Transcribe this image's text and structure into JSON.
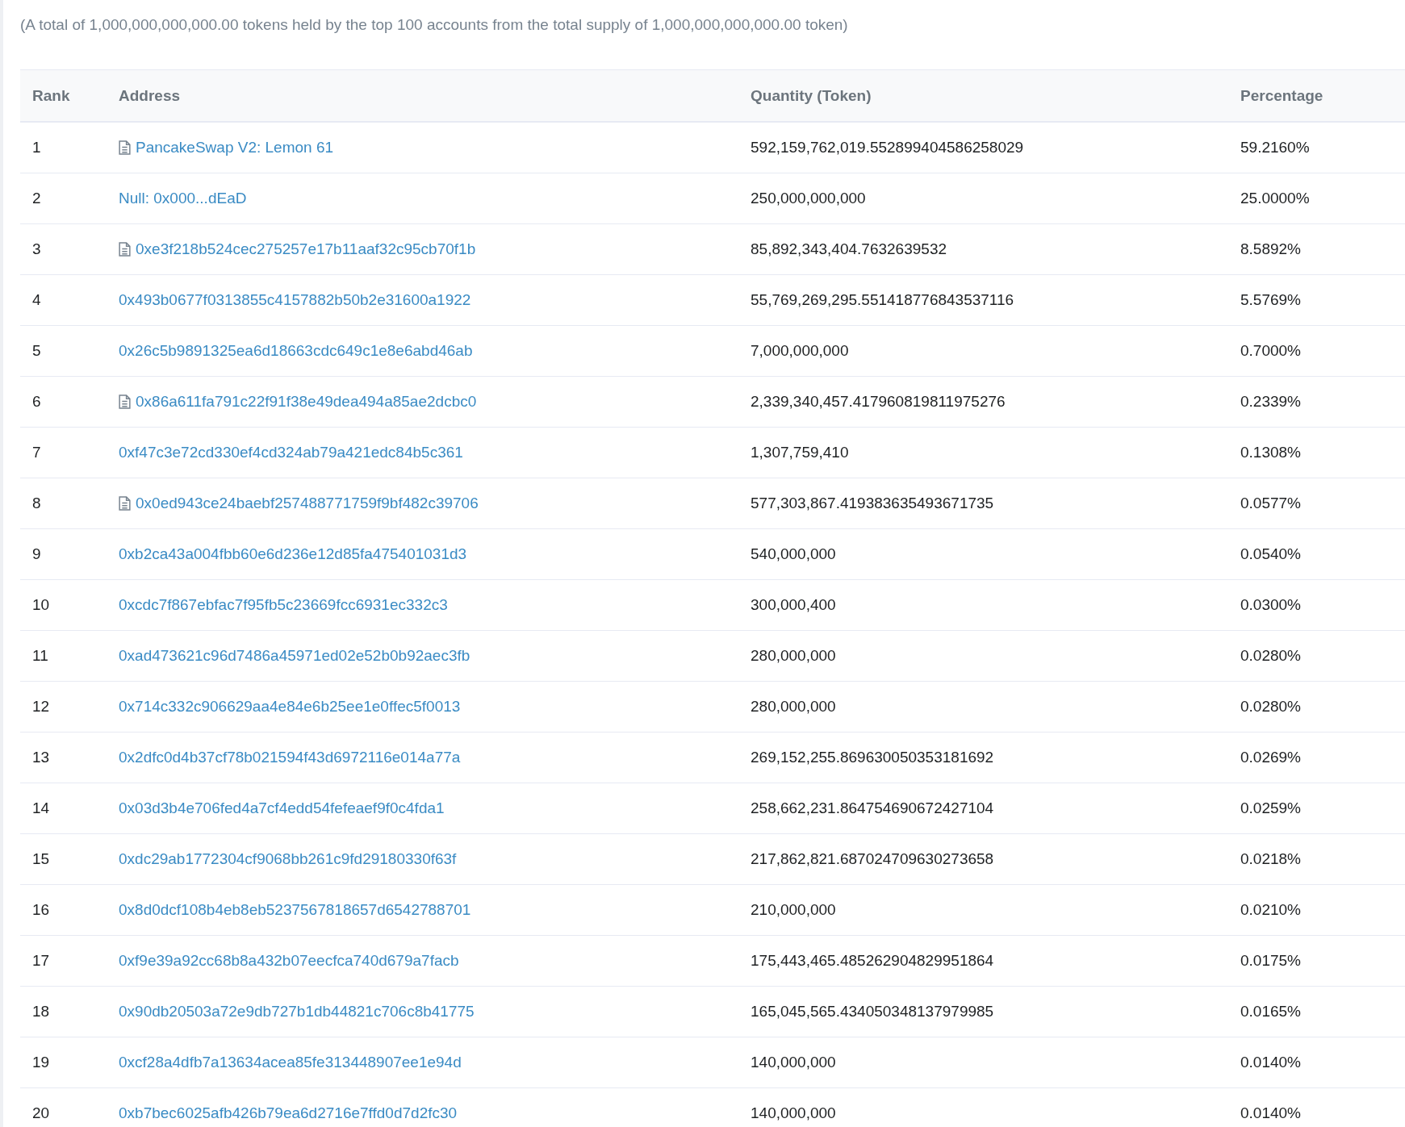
{
  "summary": "(A total of 1,000,000,000,000.00 tokens held by the top 100 accounts from the total supply of 1,000,000,000,000.00 token)",
  "table": {
    "columns": [
      "Rank",
      "Address",
      "Quantity (Token)",
      "Percentage"
    ],
    "rows": [
      {
        "rank": "1",
        "address": "PancakeSwap V2: Lemon 61",
        "contract": true,
        "quantity": "592,159,762,019.552899404586258029",
        "percentage": "59.2160%"
      },
      {
        "rank": "2",
        "address": "Null: 0x000...dEaD",
        "contract": false,
        "quantity": "250,000,000,000",
        "percentage": "25.0000%"
      },
      {
        "rank": "3",
        "address": "0xe3f218b524cec275257e17b11aaf32c95cb70f1b",
        "contract": true,
        "quantity": "85,892,343,404.7632639532",
        "percentage": "8.5892%"
      },
      {
        "rank": "4",
        "address": "0x493b0677f0313855c4157882b50b2e31600a1922",
        "contract": false,
        "quantity": "55,769,269,295.551418776843537116",
        "percentage": "5.5769%"
      },
      {
        "rank": "5",
        "address": "0x26c5b9891325ea6d18663cdc649c1e8e6abd46ab",
        "contract": false,
        "quantity": "7,000,000,000",
        "percentage": "0.7000%"
      },
      {
        "rank": "6",
        "address": "0x86a611fa791c22f91f38e49dea494a85ae2dcbc0",
        "contract": true,
        "quantity": "2,339,340,457.417960819811975276",
        "percentage": "0.2339%"
      },
      {
        "rank": "7",
        "address": "0xf47c3e72cd330ef4cd324ab79a421edc84b5c361",
        "contract": false,
        "quantity": "1,307,759,410",
        "percentage": "0.1308%"
      },
      {
        "rank": "8",
        "address": "0x0ed943ce24baebf257488771759f9bf482c39706",
        "contract": true,
        "quantity": "577,303,867.419383635493671735",
        "percentage": "0.0577%"
      },
      {
        "rank": "9",
        "address": "0xb2ca43a004fbb60e6d236e12d85fa475401031d3",
        "contract": false,
        "quantity": "540,000,000",
        "percentage": "0.0540%"
      },
      {
        "rank": "10",
        "address": "0xcdc7f867ebfac7f95fb5c23669fcc6931ec332c3",
        "contract": false,
        "quantity": "300,000,400",
        "percentage": "0.0300%"
      },
      {
        "rank": "11",
        "address": "0xad473621c96d7486a45971ed02e52b0b92aec3fb",
        "contract": false,
        "quantity": "280,000,000",
        "percentage": "0.0280%"
      },
      {
        "rank": "12",
        "address": "0x714c332c906629aa4e84e6b25ee1e0ffec5f0013",
        "contract": false,
        "quantity": "280,000,000",
        "percentage": "0.0280%"
      },
      {
        "rank": "13",
        "address": "0x2dfc0d4b37cf78b021594f43d6972116e014a77a",
        "contract": false,
        "quantity": "269,152,255.869630050353181692",
        "percentage": "0.0269%"
      },
      {
        "rank": "14",
        "address": "0x03d3b4e706fed4a7cf4edd54fefeaef9f0c4fda1",
        "contract": false,
        "quantity": "258,662,231.864754690672427104",
        "percentage": "0.0259%"
      },
      {
        "rank": "15",
        "address": "0xdc29ab1772304cf9068bb261c9fd29180330f63f",
        "contract": false,
        "quantity": "217,862,821.687024709630273658",
        "percentage": "0.0218%"
      },
      {
        "rank": "16",
        "address": "0x8d0dcf108b4eb8eb5237567818657d6542788701",
        "contract": false,
        "quantity": "210,000,000",
        "percentage": "0.0210%"
      },
      {
        "rank": "17",
        "address": "0xf9e39a92cc68b8a432b07eecfca740d679a7facb",
        "contract": false,
        "quantity": "175,443,465.485262904829951864",
        "percentage": "0.0175%"
      },
      {
        "rank": "18",
        "address": "0x90db20503a72e9db727b1db44821c706c8b41775",
        "contract": false,
        "quantity": "165,045,565.434050348137979985",
        "percentage": "0.0165%"
      },
      {
        "rank": "19",
        "address": "0xcf28a4dfb7a13634acea85fe313448907ee1e94d",
        "contract": false,
        "quantity": "140,000,000",
        "percentage": "0.0140%"
      },
      {
        "rank": "20",
        "address": "0xb7bec6025afb426b79ea6d2716e7ffd0d7d2fc30",
        "contract": false,
        "quantity": "140,000,000",
        "percentage": "0.0140%"
      }
    ]
  }
}
